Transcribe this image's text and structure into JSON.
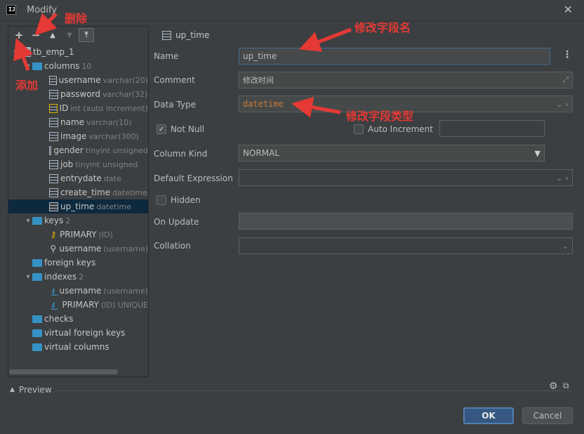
{
  "window": {
    "title": "Modify",
    "close_glyph": "✕"
  },
  "toolbar": {
    "add": "+",
    "remove": "−",
    "up": "▲",
    "down": "▼",
    "pin": "⤒"
  },
  "tree": {
    "table": "tb_emp_1",
    "columns_label": "columns",
    "columns_count": "10",
    "columns": [
      {
        "name": "username",
        "type": "varchar(20)"
      },
      {
        "name": "password",
        "type": "varchar(32)"
      },
      {
        "name": "ID",
        "type": "int (auto increment)"
      },
      {
        "name": "name",
        "type": "varchar(10)"
      },
      {
        "name": "image",
        "type": "varchar(300)"
      },
      {
        "name": "gender",
        "type": "tinyint unsigned"
      },
      {
        "name": "job",
        "type": "tinyint unsigned"
      },
      {
        "name": "entrydate",
        "type": "date"
      },
      {
        "name": "create_time",
        "type": "datetime"
      },
      {
        "name": "up_time",
        "type": "datetime"
      }
    ],
    "keys_label": "keys",
    "keys_count": "2",
    "keys": [
      {
        "name": "PRIMARY",
        "detail": "(ID)"
      },
      {
        "name": "username",
        "detail": "(username)"
      }
    ],
    "foreign_keys": "foreign keys",
    "indexes_label": "indexes",
    "indexes_count": "2",
    "indexes": [
      {
        "name": "username",
        "detail": "(username)"
      },
      {
        "name": "PRIMARY",
        "detail": "(ID) UNIQUE"
      }
    ],
    "checks": "checks",
    "virtual_foreign_keys": "virtual foreign keys",
    "virtual_columns": "virtual columns"
  },
  "form": {
    "header": "up_time",
    "name_label": "Name",
    "name_value": "up_time",
    "comment_label": "Comment",
    "comment_value": "修改时间",
    "datatype_label": "Data Type",
    "datatype_value": "datetime",
    "notnull_label": "Not Null",
    "notnull_checked": true,
    "autoinc_label": "Auto Increment",
    "autoinc_checked": false,
    "columnkind_label": "Column Kind",
    "columnkind_value": "NORMAL",
    "defaultexpr_label": "Default Expression",
    "defaultexpr_value": "",
    "hidden_label": "Hidden",
    "hidden_checked": false,
    "onupdate_label": "On Update",
    "onupdate_value": "",
    "collation_label": "Collation",
    "collation_value": ""
  },
  "preview": {
    "label": "Preview"
  },
  "buttons": {
    "ok": "OK",
    "cancel": "Cancel"
  },
  "annotations": {
    "delete": "删除",
    "add": "添加",
    "rename": "修改字段名",
    "retype": "修改字段类型",
    "color": "#e53935"
  }
}
